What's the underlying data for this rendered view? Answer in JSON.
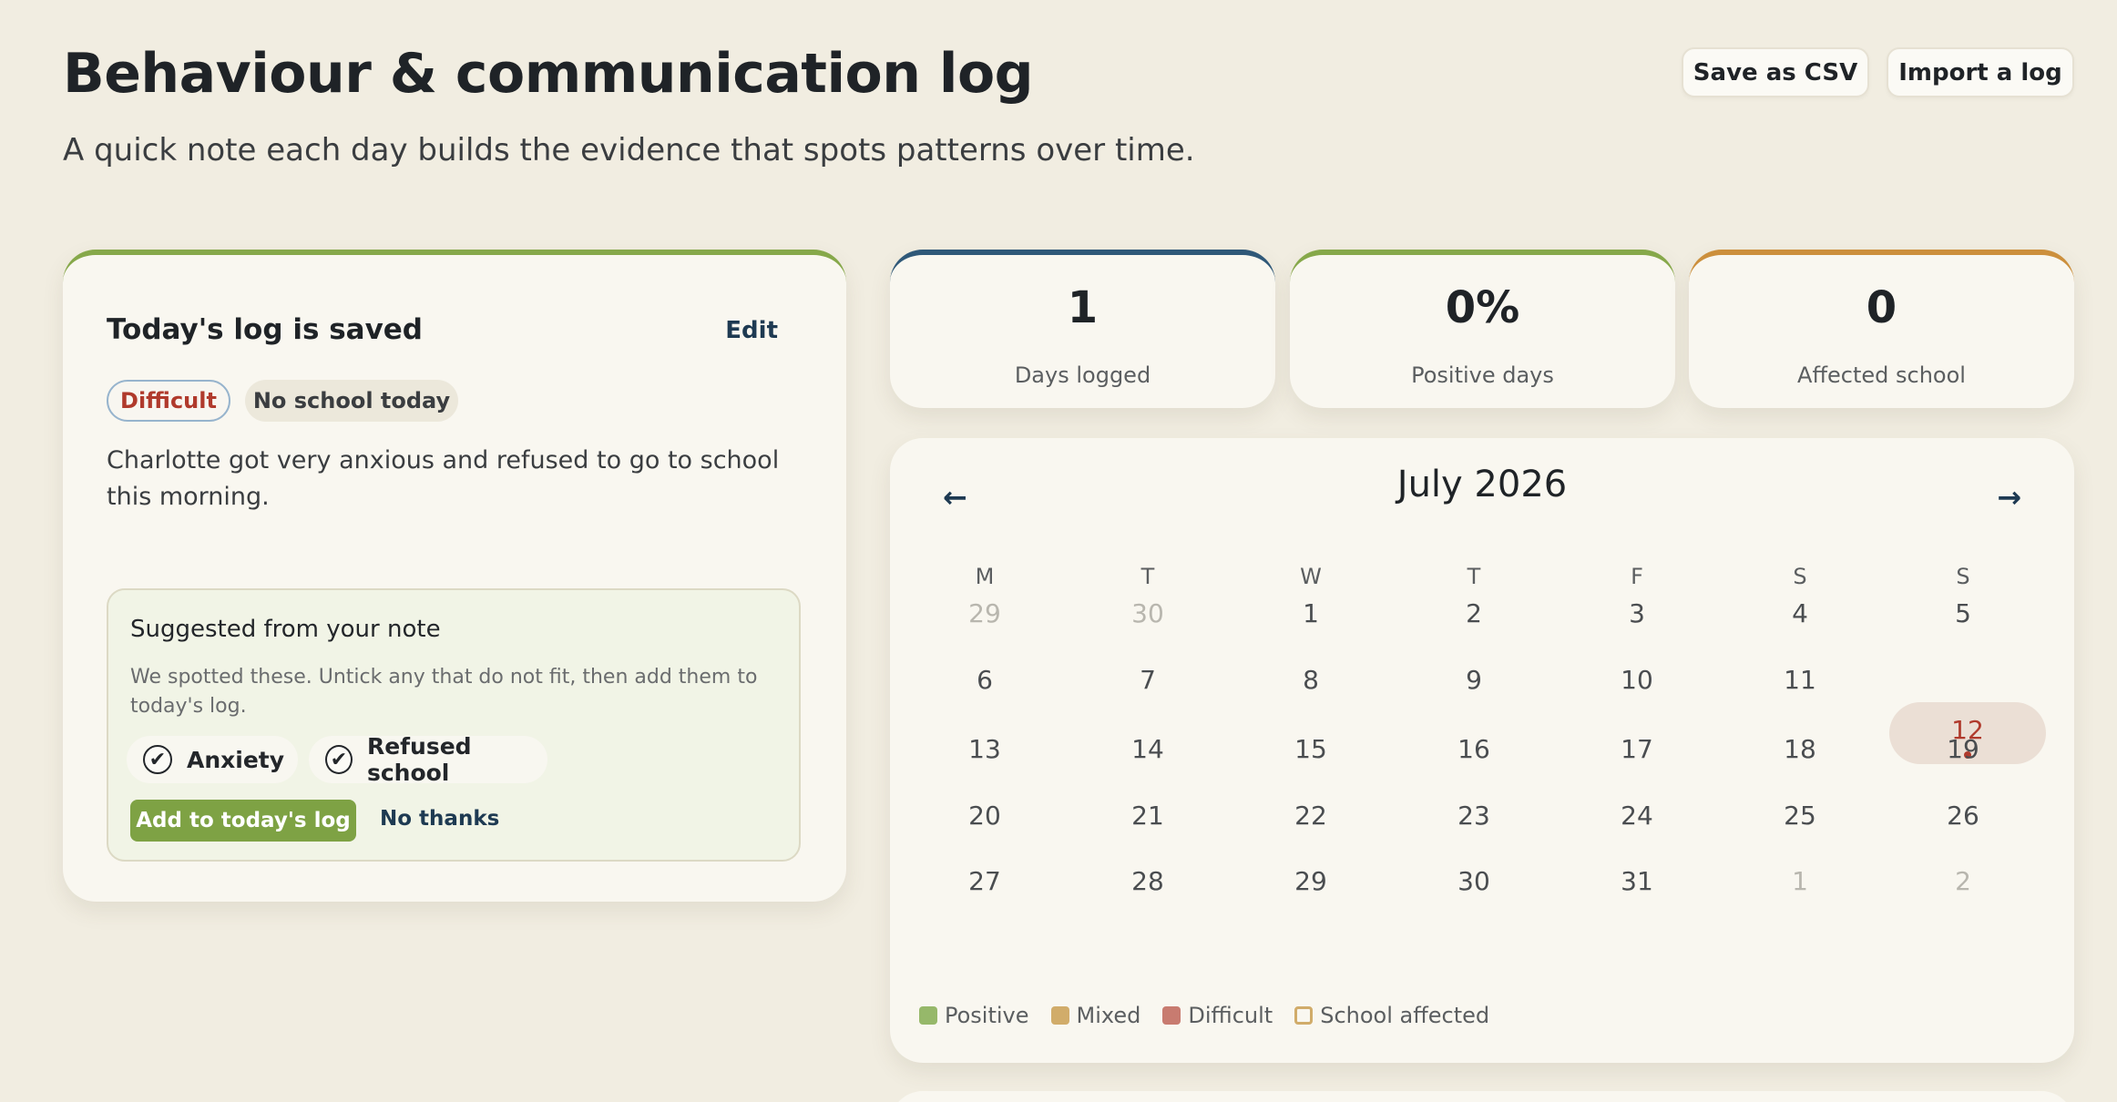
{
  "header": {
    "title": "Behaviour & communication log",
    "subtitle": "A quick note each day builds the evidence that spots patterns over time.",
    "save_csv": "Save as CSV",
    "import_log": "Import a log"
  },
  "today": {
    "title": "Today's log is saved",
    "edit": "Edit",
    "chips": {
      "mood": "Difficult",
      "school": "No school today"
    },
    "note": "Charlotte got very anxious and refused to go to school this morning.",
    "suggest": {
      "title": "Suggested from your note",
      "desc": "We spotted these. Untick any that do not fit, then add them to today's log.",
      "tags": [
        {
          "label": "Anxiety",
          "checked": true
        },
        {
          "label": "Refused school",
          "checked": true
        }
      ],
      "add": "Add to today's log",
      "decline": "No thanks"
    }
  },
  "stats": [
    {
      "value": "1",
      "label": "Days logged"
    },
    {
      "value": "0%",
      "label": "Positive days"
    },
    {
      "value": "0",
      "label": "Affected school"
    }
  ],
  "calendar": {
    "month": "July 2026",
    "prev_icon": "arrow-left-icon",
    "next_icon": "arrow-right-icon",
    "weekdays": [
      "M",
      "T",
      "W",
      "T",
      "F",
      "S",
      "S"
    ],
    "weeks": [
      [
        "29",
        "30",
        "1",
        "2",
        "3",
        "4",
        "5"
      ],
      [
        "6",
        "7",
        "8",
        "9",
        "10",
        "11",
        "12"
      ],
      [
        "13",
        "14",
        "15",
        "16",
        "17",
        "18",
        "19"
      ],
      [
        "20",
        "21",
        "22",
        "23",
        "24",
        "25",
        "26"
      ],
      [
        "27",
        "28",
        "29",
        "30",
        "31",
        "1",
        "2"
      ]
    ],
    "today": "12",
    "legend": {
      "positive": "Positive",
      "mixed": "Mixed",
      "difficult": "Difficult",
      "school": "School affected"
    }
  },
  "colors": {
    "background": "#f1ede1",
    "accent_green": "#7ea244",
    "accent_blue": "#2f5878",
    "accent_orange": "#cc8f3c",
    "difficult_red": "#b03a2c"
  }
}
